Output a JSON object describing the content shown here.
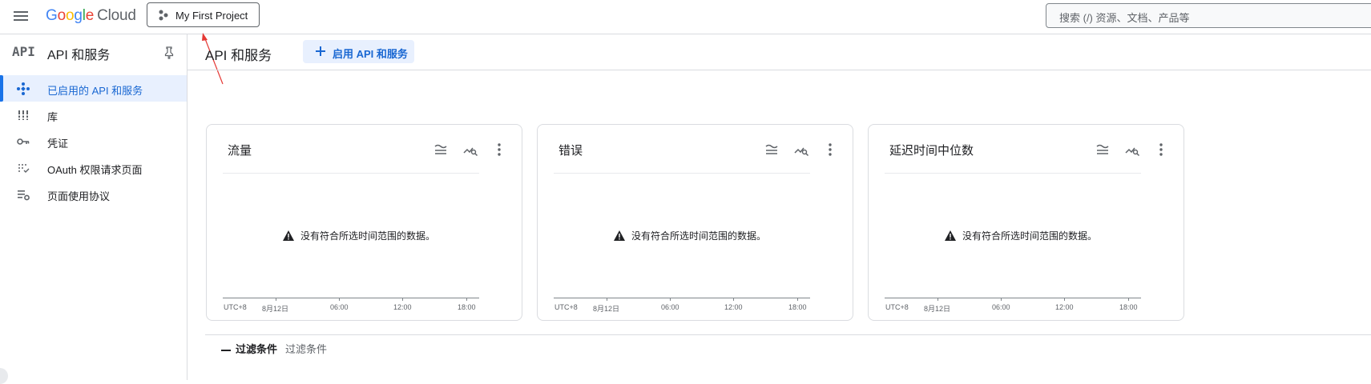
{
  "topbar": {
    "logo_letters": [
      "G",
      "o",
      "o",
      "g",
      "l",
      "e"
    ],
    "logo_colors": [
      "#4285f4",
      "#ea4335",
      "#fbbc04",
      "#4285f4",
      "#34a853",
      "#ea4335"
    ],
    "logo_product": "Cloud",
    "project_label": "My First Project",
    "search_placeholder": "搜索 (/) 资源、文档、产品等"
  },
  "sidebar": {
    "logo_text": "API",
    "title": "API 和服务",
    "items": [
      {
        "label": "已启用的 API 和服务",
        "icon": "api-diamond-icon",
        "active": true
      },
      {
        "label": "库",
        "icon": "library-icon",
        "active": false
      },
      {
        "label": "凭证",
        "icon": "key-icon",
        "active": false
      },
      {
        "label": "OAuth 权限请求页面",
        "icon": "oauth-consent-icon",
        "active": false
      },
      {
        "label": "页面使用协议",
        "icon": "page-usage-settings-icon",
        "active": false
      }
    ]
  },
  "main": {
    "title": "API 和服务",
    "enable_button": "启用 API 和服务"
  },
  "cards": [
    {
      "title": "流量",
      "message": "没有符合所选时间范围的数据。",
      "axis_labels": [
        "UTC+8",
        "8月12日",
        "06:00",
        "12:00",
        "18:00"
      ]
    },
    {
      "title": "错误",
      "message": "没有符合所选时间范围的数据。",
      "axis_labels": [
        "UTC+8",
        "8月12日",
        "06:00",
        "12:00",
        "18:00"
      ]
    },
    {
      "title": "延迟时间中位数",
      "message": "没有符合所选时间范围的数据。",
      "axis_labels": [
        "UTC+8",
        "8月12日",
        "06:00",
        "12:00",
        "18:00"
      ]
    }
  ],
  "filter": {
    "label": "过滤条件",
    "placeholder": "过滤条件"
  },
  "colors": {
    "accent": "#1a73e8",
    "accent_text": "#1967d2",
    "active_bg": "#e8f0fe",
    "annotation_arrow": "#e53935"
  }
}
